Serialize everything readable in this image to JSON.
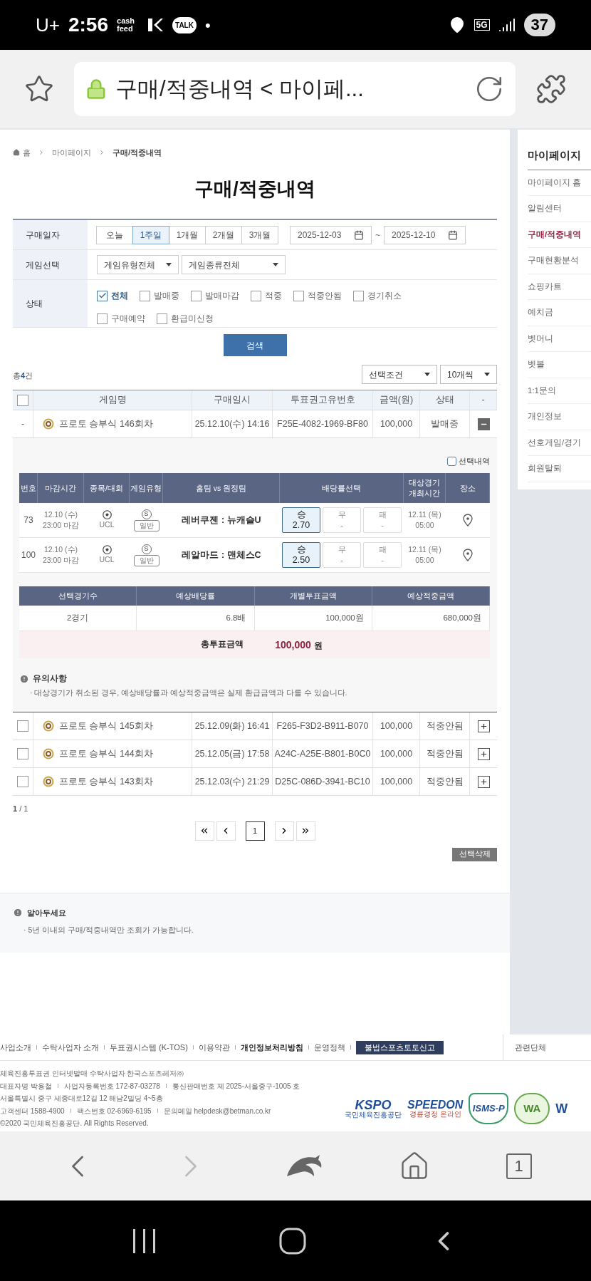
{
  "status_bar": {
    "carrier": "U+",
    "time": "2:56",
    "apps": [
      "cash feed",
      "TALK"
    ],
    "dot": "•",
    "network": "5G",
    "battery": "37"
  },
  "browser": {
    "url_title": "구매/적중내역 < 마이페..."
  },
  "breadcrumb": [
    "홈",
    "마이페이지",
    "구매/적중내역"
  ],
  "title": "구매/적중내역",
  "filters": {
    "date_label": "구매일자",
    "periods": [
      {
        "label": "오늘",
        "selected": false
      },
      {
        "label": "1주일",
        "selected": true
      },
      {
        "label": "1개월",
        "selected": false
      },
      {
        "label": "2개월",
        "selected": false
      },
      {
        "label": "3개월",
        "selected": false
      }
    ],
    "date_from": "2025-12-03",
    "date_sep": "~",
    "date_to": "2025-12-10",
    "game_label": "게임선택",
    "game_selects": [
      "게임유형전체",
      "게임종류전체"
    ],
    "status_label": "상태",
    "statuses": [
      {
        "label": "전체",
        "checked": true
      },
      {
        "label": "발매중",
        "checked": false
      },
      {
        "label": "발매마감",
        "checked": false
      },
      {
        "label": "적중",
        "checked": false
      },
      {
        "label": "적중안됨",
        "checked": false
      },
      {
        "label": "경기취소",
        "checked": false
      },
      {
        "label": "구매예약",
        "checked": false
      },
      {
        "label": "환급미신청",
        "checked": false
      }
    ]
  },
  "search_button": "검색",
  "total": {
    "prefix": "총",
    "count": "4",
    "suffix": "건"
  },
  "list_selects": [
    "선택조건",
    "10개씩"
  ],
  "table": {
    "select_all_checked": false,
    "columns": [
      "게임명",
      "구매일시",
      "투표권고유번호",
      "금액(원)",
      "상태",
      "-"
    ],
    "rows": [
      {
        "lead": "-",
        "name": "프로토 승부식 146회차",
        "date": "25.12.10(수) 14:16",
        "ticket": "F25E-4082-1969-BF80",
        "amount": "100,000",
        "status": "발매중",
        "expanded": true
      },
      {
        "checked": false,
        "name": "프로토 승부식 145회차",
        "date": "25.12.09(화) 16:41",
        "ticket": "F265-F3D2-B911-B070",
        "amount": "100,000",
        "status": "적중안됨",
        "expanded": false
      },
      {
        "checked": false,
        "name": "프로토 승부식 144회차",
        "date": "25.12.05(금) 17:58",
        "ticket": "A24C-A25E-B801-B0C0",
        "amount": "100,000",
        "status": "적중안됨",
        "expanded": false
      },
      {
        "checked": false,
        "name": "프로토 승부식 143회차",
        "date": "25.12.03(수) 21:29",
        "ticket": "D25C-086D-3941-BC10",
        "amount": "100,000",
        "status": "적중안됨",
        "expanded": false
      }
    ]
  },
  "detail": {
    "select_label": "선택내역",
    "select_checked": false,
    "columns": [
      "번호",
      "마감시간",
      "종목/대회",
      "게임유형",
      "홈팀 vs 원정팀",
      "배당률선택",
      "대상경기 개최시간",
      "장소"
    ],
    "matches": [
      {
        "no": "73",
        "deadline_date": "12.10 (수)",
        "deadline_time": "23:00 마감",
        "league": "UCL",
        "badge": "S",
        "game_type": "일반",
        "teams": "레버쿠젠 : 뉴캐슬U",
        "odds": [
          {
            "label": "승",
            "value": "2.70",
            "selected": true
          },
          {
            "label": "무",
            "value": "-",
            "selected": false
          },
          {
            "label": "패",
            "value": "-",
            "selected": false
          }
        ],
        "start_date": "12.11 (목)",
        "start_time": "05:00"
      },
      {
        "no": "100",
        "deadline_date": "12.10 (수)",
        "deadline_time": "23:00 마감",
        "league": "UCL",
        "badge": "S",
        "game_type": "일반",
        "teams": "레알마드 : 맨체스C",
        "odds": [
          {
            "label": "승",
            "value": "2.50",
            "selected": true
          },
          {
            "label": "무",
            "value": "-",
            "selected": false
          },
          {
            "label": "패",
            "value": "-",
            "selected": false
          }
        ],
        "start_date": "12.11 (목)",
        "start_time": "05:00"
      }
    ],
    "summary_columns": [
      "선택경기수",
      "예상배당률",
      "개별투표금액",
      "예상적중금액"
    ],
    "summary_values": [
      "2경기",
      "6.8배",
      "100,000원",
      "680,000원"
    ],
    "total_label": "총투표금액",
    "total_amount": "100,000",
    "total_unit": "원",
    "notice_title": "유의사항",
    "notice_text": "· 대상경기가 취소된 경우, 예상배당률과 예상적중금액은 실제 환급금액과 다를 수 있습니다."
  },
  "page_info": "**1** / 1",
  "pages": [
    {
      "label": "1",
      "selected": true
    }
  ],
  "delete_button": "선택삭제",
  "info": {
    "title": "알아두세요",
    "text": "· 5년 이내의 구매/적중내역만 조회가 가능합니다."
  },
  "sidebar": {
    "title": "마이페이지",
    "items": [
      {
        "label": "마이페이지 홈",
        "selected": false
      },
      {
        "label": "알림센터",
        "selected": false
      },
      {
        "label": "구매/적중내역",
        "selected": true
      },
      {
        "label": "구매현황분석",
        "selected": false
      },
      {
        "label": "쇼핑카트",
        "selected": false
      },
      {
        "label": "예치금",
        "selected": false
      },
      {
        "label": "벳머니",
        "selected": false
      },
      {
        "label": "벳볼",
        "selected": false
      },
      {
        "label": "1:1문의",
        "selected": false
      },
      {
        "label": "개인정보",
        "selected": false
      },
      {
        "label": "선호게임/경기",
        "selected": false
      },
      {
        "label": "회원탈퇴",
        "selected": false
      }
    ]
  },
  "footer": {
    "links": [
      {
        "label": "사업소개",
        "kind": "plain"
      },
      {
        "label": "수탁사업자 소개",
        "kind": "plain"
      },
      {
        "label": "투표권시스템 (K-TOS)",
        "kind": "plain"
      },
      {
        "label": "이용약관",
        "kind": "plain"
      },
      {
        "label": "개인정보처리방침",
        "kind": "bold"
      },
      {
        "label": "운영정책",
        "kind": "plain"
      },
      {
        "label": "불법스포츠토토신고",
        "kind": "button"
      }
    ],
    "related": "관련단체",
    "lines": [
      [
        "체육진흥투표권 인터넷발매 수탁사업자 한국스포츠레저㈜"
      ],
      [
        "대표자명 박용철",
        "사업자등록번호 172-87-03278",
        "통신판매번호 제 2025-서울중구-1005 호"
      ],
      [
        "서울특별시 중구 세종대로12길 12 해남2빌딩 4~5층"
      ],
      [
        "고객센터 1588-4900",
        "팩스번호 02-6969-6195",
        "문의메일 helpdesk@betman.co.kr"
      ],
      [
        "©2020 국민체육진흥공단. All Rights Reserved."
      ]
    ],
    "logos": [
      {
        "name": "KSPO",
        "sub": "국민체육진흥공단",
        "kind": "kspo"
      },
      {
        "name": "SPEEDON",
        "sub": "경륜경정 온라인",
        "kind": "speedon"
      },
      {
        "name": "ISMS-P",
        "kind": "shield"
      },
      {
        "name": "WA",
        "kind": "circle"
      },
      {
        "name": "W",
        "kind": "cut"
      }
    ]
  },
  "nav": {
    "tabs": "1"
  }
}
